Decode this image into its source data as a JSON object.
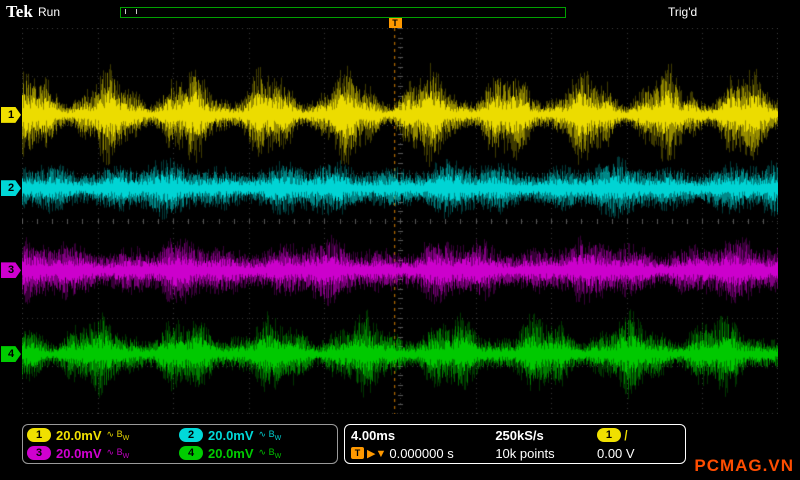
{
  "header": {
    "logo": "Tek",
    "acq_status": "Run",
    "trigger_status": "Trig'd"
  },
  "display": {
    "grid": {
      "cols": 10,
      "rows": 8
    },
    "grid_dot_color": "#3a3a3a",
    "center_tick_color": "#5a5a5a",
    "trigger_x_frac": 0.493
  },
  "channels": [
    {
      "label": "1",
      "scale": "20.0mV",
      "color": "#f0e000",
      "coupling_icon": "~",
      "bw_icon": "B",
      "bw_sub": "W",
      "center_frac": 0.225,
      "base_amp": 46,
      "mod_depth": 0.72,
      "mod_cycles": 9.5,
      "phase": 1.0
    },
    {
      "label": "2",
      "scale": "20.0mV",
      "color": "#00d8d8",
      "coupling_icon": "~",
      "bw_icon": "B",
      "bw_sub": "W",
      "center_frac": 0.415,
      "base_amp": 27,
      "mod_depth": 0.32,
      "mod_cycles": 5.0,
      "phase": 2.1
    },
    {
      "label": "3",
      "scale": "20.0mV",
      "color": "#d000d0",
      "coupling_icon": "~",
      "bw_icon": "B",
      "bw_sub": "W",
      "center_frac": 0.628,
      "base_amp": 31,
      "mod_depth": 0.38,
      "mod_cycles": 5.5,
      "phase": 0.6
    },
    {
      "label": "4",
      "scale": "20.0mV",
      "color": "#00cc00",
      "coupling_icon": "~",
      "bw_icon": "B",
      "bw_sub": "W",
      "center_frac": 0.845,
      "base_amp": 38,
      "mod_depth": 0.62,
      "mod_cycles": 8.5,
      "phase": 2.6
    }
  ],
  "timebase": {
    "scale": "4.00ms",
    "sample_rate": "250kS/s",
    "record_length": "10k points",
    "position": "0.000000 s"
  },
  "trigger": {
    "source": "1",
    "source_color": "#f0e000",
    "slope": "/",
    "level": "0.00 V",
    "marker_color": "#ff9900"
  },
  "watermark": "PCMAG.VN"
}
